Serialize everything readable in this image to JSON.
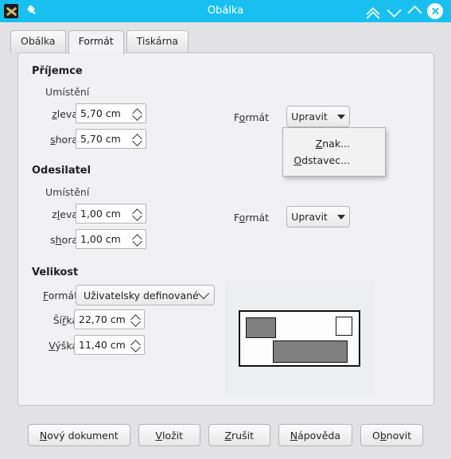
{
  "window": {
    "title": "Obálka",
    "app_icon": "writer-icon",
    "pin_icon": "pin-icon",
    "controls": {
      "shade_label": "shade-icon",
      "minimize_label": "minimize-icon",
      "maximize_label": "maximize-icon",
      "close_label": "close-icon"
    },
    "titlebar_color": "#18c0ef"
  },
  "tabs": [
    {
      "label": "Obálka",
      "active": false
    },
    {
      "label": "Formát",
      "active": true
    },
    {
      "label": "Tiskárna",
      "active": false
    }
  ],
  "recipient": {
    "group_title": "Příjemce",
    "position_label": "Umístění",
    "from_left": {
      "label_pre": "",
      "label_accel": "z",
      "label_post": "leva",
      "value": "5,70 cm"
    },
    "from_top": {
      "label_pre": "",
      "label_accel": "s",
      "label_post": "hora",
      "value": "5,70 cm"
    },
    "format_label_pre": "F",
    "format_label_accel": "o",
    "format_label_post": "rmát",
    "format_button": "Upravit"
  },
  "sender": {
    "group_title": "Odesilatel",
    "position_label": "Umístění",
    "from_left": {
      "label_pre": "z",
      "label_accel": "l",
      "label_post": "eva",
      "value": "1,00 cm"
    },
    "from_top": {
      "label_pre": "s",
      "label_accel": "h",
      "label_post": "ora",
      "value": "1,00 cm"
    },
    "format_label_pre": "F",
    "format_label_accel": "o",
    "format_label_post": "rmát",
    "format_button": "Upravit"
  },
  "size": {
    "group_title": "Velikost",
    "format_label_pre": "",
    "format_label_accel": "F",
    "format_label_post": "ormát",
    "format_value": "Uživatelsky definované",
    "width": {
      "label_pre": "Ší",
      "label_accel": "ř",
      "label_post": "ka",
      "value": "22,70 cm"
    },
    "height": {
      "label_pre": "",
      "label_accel": "V",
      "label_post": "ýška",
      "value": "11,40 cm"
    }
  },
  "menu": {
    "visible": true,
    "items": [
      {
        "pre": "",
        "accel": "Z",
        "post": "nak..."
      },
      {
        "pre": "",
        "accel": "O",
        "post": "dstavec..."
      }
    ]
  },
  "preview": {
    "name": "envelope-preview",
    "sender_block": "sender-block",
    "stamp_block": "stamp-block",
    "recipient_block": "recipient-block",
    "block_color": "#808080"
  },
  "buttons": [
    {
      "pre": "",
      "accel": "N",
      "post": "ový dokument"
    },
    {
      "pre": "",
      "accel": "V",
      "post": "ložit"
    },
    {
      "pre": "",
      "accel": "Z",
      "post": "rušit"
    },
    {
      "pre": "",
      "accel": "N",
      "post": "ápověda"
    },
    {
      "pre": "O",
      "accel": "b",
      "post": "novit"
    }
  ]
}
